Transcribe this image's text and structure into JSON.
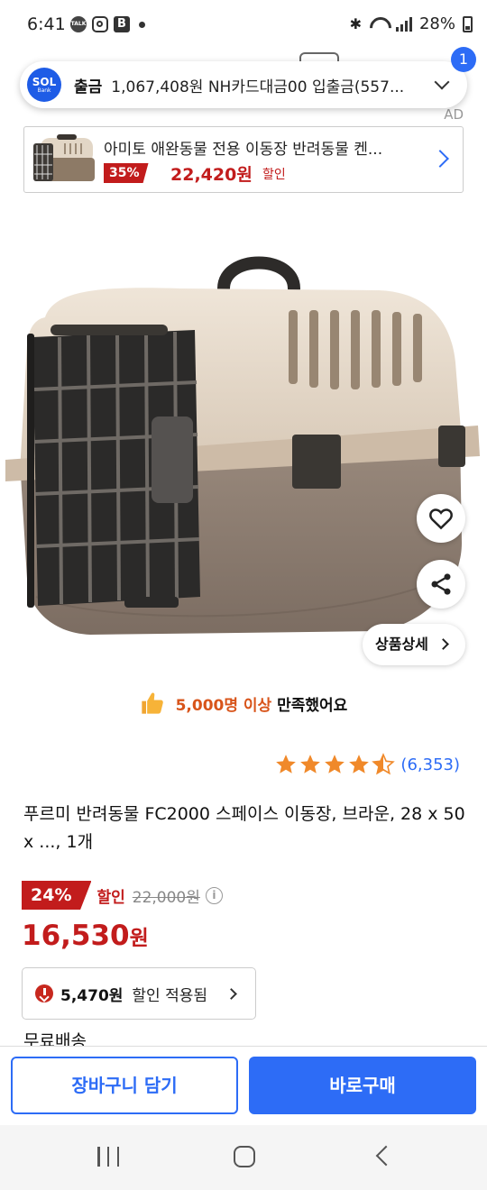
{
  "status_bar": {
    "time": "6:41",
    "talk_badge": "TALK",
    "b_badge": "B",
    "battery": "28%"
  },
  "notification": {
    "badge_count": "1",
    "logo_line1": "SOL",
    "logo_line2": "Bank",
    "title": "출금",
    "text": "1,067,408원 NH카드대금00 입출금(557..."
  },
  "ad": {
    "label": "AD",
    "title": "아미토 애완동물 전용 이동장 반려동물 켄...",
    "discount_pct": "35%",
    "price": "22,420원",
    "discount_label": "할인"
  },
  "hero": {
    "detail_button": "상품상세"
  },
  "satisfaction": {
    "count": "5,000명 이상",
    "suffix": " 만족했어요"
  },
  "rating": {
    "stars": 4.5,
    "count": "(6,353)"
  },
  "product": {
    "title": "푸르미 반려동물 FC2000 스페이스 이동장, 브라운, 28 x 50 x ..., 1개",
    "discount_pct": "24%",
    "discount_label": "할인",
    "original_price": "22,000원",
    "sale_price": "16,530",
    "sale_unit": "원"
  },
  "coupon": {
    "amount": "5,470원",
    "text": "할인 적용됨"
  },
  "shipping": {
    "label": "무료배송"
  },
  "actions": {
    "cart": "장바구니 담기",
    "buy": "바로구매"
  },
  "colors": {
    "accent": "#2d6cf6",
    "sale_red": "#c21c1c",
    "highlight_orange": "#d8541a",
    "star": "#f0892a"
  }
}
